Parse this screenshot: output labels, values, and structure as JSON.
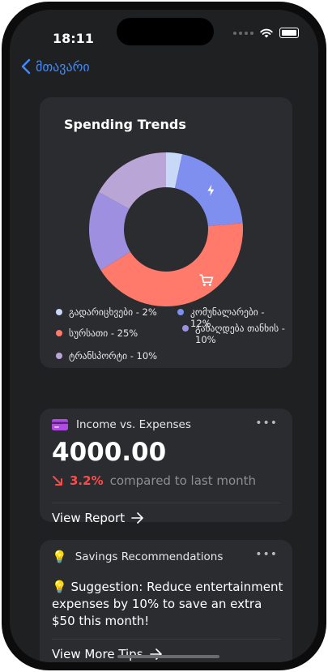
{
  "status_bar": {
    "time": "18:11"
  },
  "nav": {
    "back_label": "მთავარი"
  },
  "spending": {
    "title": "Spending Trends",
    "legend": [
      {
        "label": "გადარიცხვები - 2%",
        "color": "#c7d9f7"
      },
      {
        "label": "კომუნალარები - 12%",
        "color": "#7f8ff0"
      },
      {
        "label": "სურსათი - 25%",
        "color": "#ff7a6b"
      },
      {
        "label": "განაღდება თანხის - 10%",
        "color": "#9f8fe0"
      },
      {
        "label": "ტრანსპორტი - 10%",
        "color": "#b9a5d6"
      }
    ]
  },
  "chart_data": {
    "type": "pie",
    "categories": [
      "გადარიცხვები",
      "კომუნალარები",
      "სურსათი",
      "განაღდება თანხის",
      "ტრანსპორტი"
    ],
    "values": [
      2,
      12,
      25,
      10,
      10
    ],
    "colors": [
      "#c7d9f7",
      "#7f8ff0",
      "#ff7a6b",
      "#9f8fe0",
      "#b9a5d6"
    ],
    "title": "Spending Trends"
  },
  "income": {
    "title": "Income vs. Expenses",
    "amount": "4000.00",
    "change_pct": "3.2%",
    "compared": "compared to last month",
    "link": "View Report",
    "more": "•••"
  },
  "savings": {
    "title": "Savings Recommendations",
    "suggestion": "💡 Suggestion: Reduce entertainment expenses by 10% to save an extra $50 this month!",
    "link": "View More Tips",
    "more": "•••"
  }
}
